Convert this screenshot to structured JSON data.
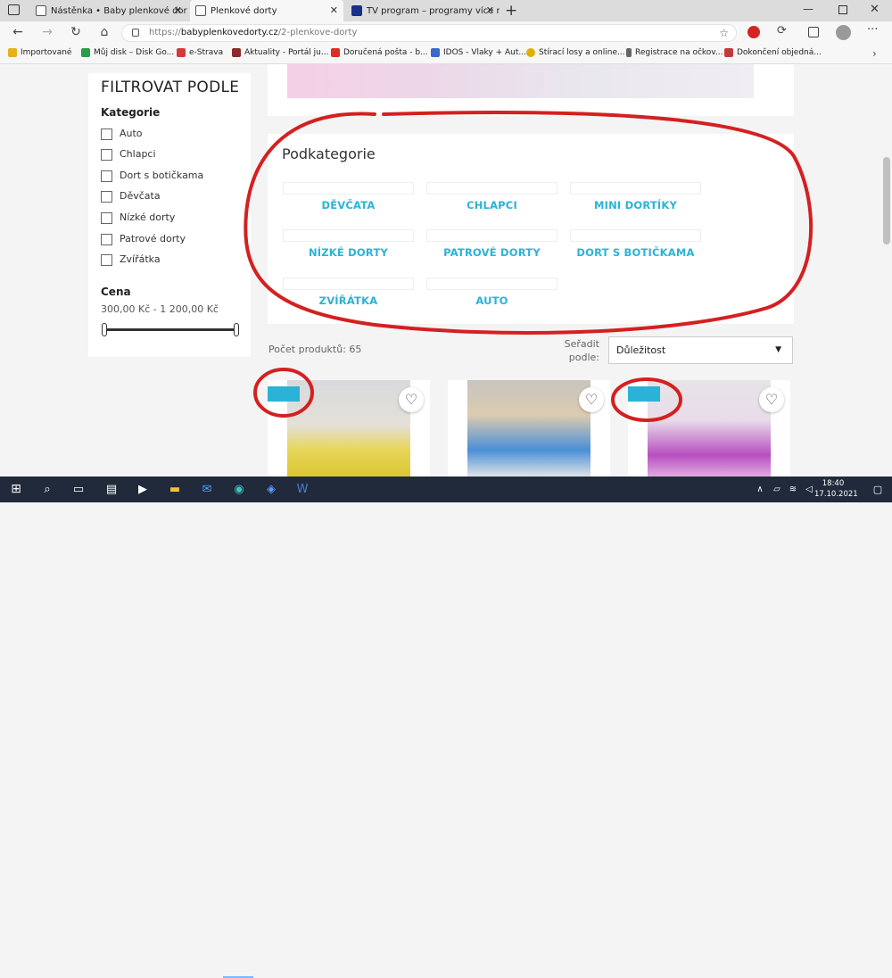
{
  "tabs": [
    {
      "title": "Nástěnka • Baby plenkové dorty",
      "active": false
    },
    {
      "title": "Plenkové dorty",
      "active": true
    },
    {
      "title": "TV program – programy více než",
      "active": false
    }
  ],
  "address": {
    "url_prefix": "https://",
    "url_domain": "babyplenkovedorty.cz",
    "url_path": "/2-plenkove-dorty"
  },
  "bookmarks": [
    {
      "label": "Importované",
      "color": "#e6b21a"
    },
    {
      "label": "Můj disk – Disk Go...",
      "color": "#2a9d4a"
    },
    {
      "label": "e-Strava",
      "color": "#d23a3a"
    },
    {
      "label": "Aktuality - Portál ju...",
      "color": "#8a2a2a"
    },
    {
      "label": "Doručená pošta - b...",
      "color": "#d93025"
    },
    {
      "label": "IDOS - Vlaky + Aut...",
      "color": "#3a6ac8"
    },
    {
      "label": "Stírací losy a online...",
      "color": "#e0b000"
    },
    {
      "label": "Registrace na očkov...",
      "color": "#666666"
    },
    {
      "label": "Dokončení objedná...",
      "color": "#c23b3b"
    }
  ],
  "sidebar": {
    "title": "FILTROVAT PODLE",
    "category_title": "Kategorie",
    "categories": [
      "Auto",
      "Chlapci",
      "Dort s botičkama",
      "Děvčata",
      "Nízké dorty",
      "Patrové dorty",
      "Zvířátka"
    ],
    "price_title": "Cena",
    "price_range": "300,00 Kč - 1 200,00 Kč"
  },
  "subcategories": {
    "title": "Podkategorie",
    "items": [
      "DĚVČATA",
      "CHLAPCI",
      "MINI DORTÍKY",
      "NÍZKÉ DORTY",
      "PATROVÉ DORTY",
      "DORT S BOTIČKAMA",
      "ZVÍŘÁTKA",
      "AUTO"
    ]
  },
  "products": {
    "count_label": "Počet produktů: 65",
    "sort_label": "Seřadit podle:",
    "sort_value": "Důležitost"
  },
  "taskbar": {
    "time": "18:40",
    "date": "17.10.2021"
  },
  "colors": {
    "accent": "#2ab3d6",
    "annotation": "#d42020"
  }
}
